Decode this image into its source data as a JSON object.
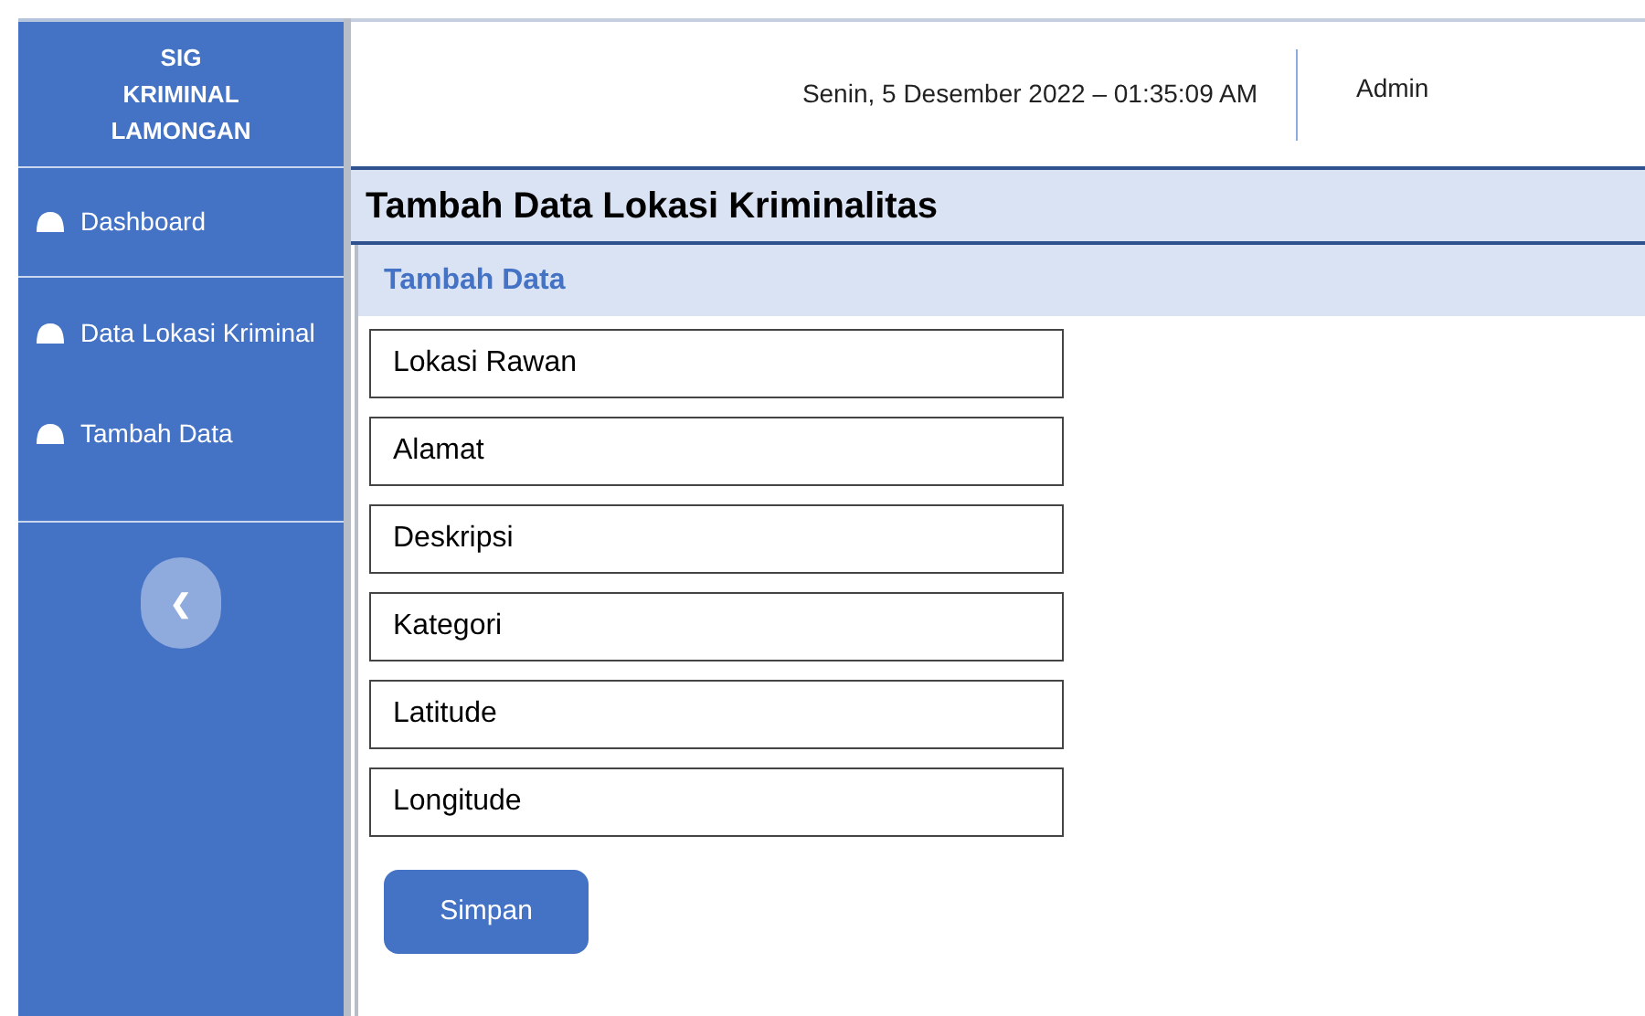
{
  "sidebar": {
    "brand": [
      "SIG",
      "KRIMINAL",
      "LAMONGAN"
    ],
    "sections": [
      {
        "items": [
          {
            "label": "Dashboard"
          }
        ]
      },
      {
        "items": [
          {
            "label": "Data Lokasi Kriminal"
          },
          {
            "label": "Tambah Data"
          }
        ]
      }
    ],
    "collapse_button": "❮"
  },
  "header": {
    "datetime": "Senin, 5 Desember 2022 – 01:35:09 AM",
    "user": "Admin"
  },
  "page_title": "Tambah Data Lokasi Kriminalitas",
  "form": {
    "title": "Tambah Data",
    "fields": [
      {
        "placeholder": "Lokasi Rawan"
      },
      {
        "placeholder": "Alamat"
      },
      {
        "placeholder": "Deskripsi"
      },
      {
        "placeholder": "Kategori"
      },
      {
        "placeholder": "Latitude"
      },
      {
        "placeholder": "Longitude"
      }
    ],
    "submit": "Simpan"
  }
}
